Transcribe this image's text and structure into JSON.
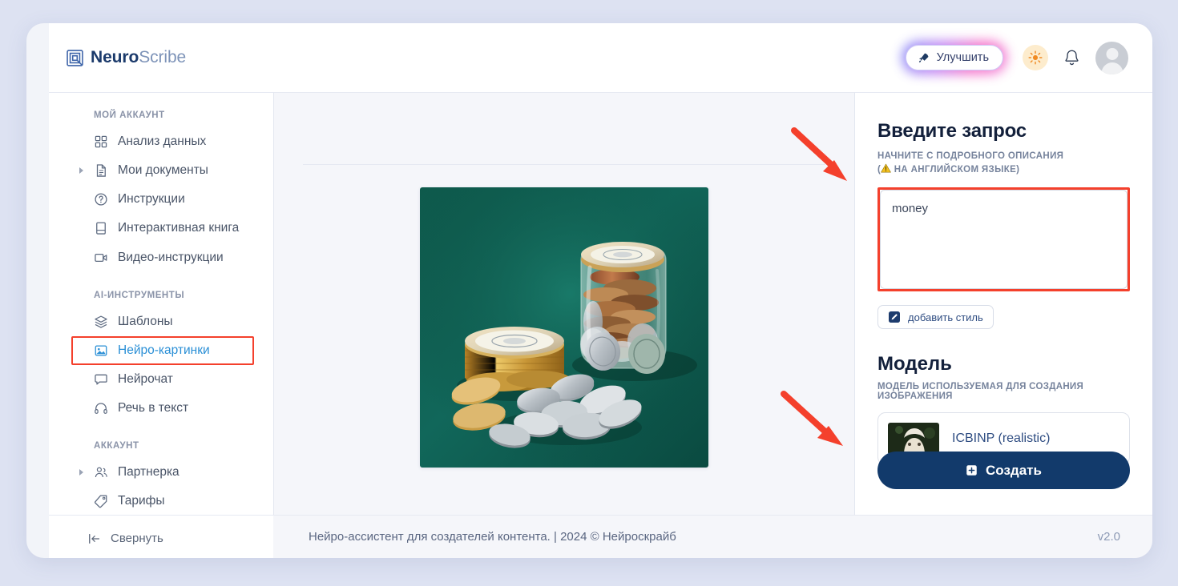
{
  "brand": {
    "name_strong": "Neuro",
    "name_light": "Scribe",
    "logo_icon": "nested-square-logo-icon"
  },
  "header": {
    "improve_label": "Улучшить",
    "improve_icon": "rocket-icon",
    "theme_icon": "sun-icon",
    "bell_icon": "bell-icon",
    "avatar_icon": "user-avatar-icon"
  },
  "sidebar": {
    "groups": [
      {
        "label": "МОЙ АККАУНТ",
        "items": [
          {
            "label": "Анализ данных",
            "icon": "grid-squares-icon",
            "expandable": false,
            "active": false,
            "highlighted": false
          },
          {
            "label": "Мои документы",
            "icon": "document-icon",
            "expandable": true,
            "active": false,
            "highlighted": false
          },
          {
            "label": "Инструкции",
            "icon": "question-circle-icon",
            "expandable": false,
            "active": false,
            "highlighted": false
          },
          {
            "label": "Интерактивная книга",
            "icon": "book-icon",
            "expandable": false,
            "active": false,
            "highlighted": false
          },
          {
            "label": "Видео-инструкции",
            "icon": "video-camera-icon",
            "expandable": false,
            "active": false,
            "highlighted": false
          }
        ]
      },
      {
        "label": "AI-ИНСТРУМЕНТЫ",
        "items": [
          {
            "label": "Шаблоны",
            "icon": "layers-icon",
            "expandable": false,
            "active": false,
            "highlighted": false
          },
          {
            "label": "Нейро-картинки",
            "icon": "image-icon",
            "expandable": false,
            "active": true,
            "highlighted": true
          },
          {
            "label": "Нейрочат",
            "icon": "chat-bubble-icon",
            "expandable": false,
            "active": false,
            "highlighted": false
          },
          {
            "label": "Речь в текст",
            "icon": "headphones-icon",
            "expandable": false,
            "active": false,
            "highlighted": false
          }
        ]
      },
      {
        "label": "АККАУНТ",
        "items": [
          {
            "label": "Партнерка",
            "icon": "users-icon",
            "expandable": true,
            "active": false,
            "highlighted": false
          },
          {
            "label": "Тарифы",
            "icon": "tag-icon",
            "expandable": false,
            "active": false,
            "highlighted": false
          }
        ]
      }
    ],
    "collapse_label": "Свернуть",
    "collapse_icon": "collapse-left-icon"
  },
  "main": {
    "generated_image_alt": "Стеклянная банка с монетами и стопка золотых монет на тёмно-зелёной поверхности"
  },
  "prompt": {
    "title": "Введите запрос",
    "subtitle_line1": "НАЧНИТЕ С ПОДРОБНОГО ОПИСАНИЯ",
    "subtitle_line2_prefix": "(",
    "subtitle_line2": "НА АНГЛИЙСКОМ ЯЗЫКЕ)",
    "warning_icon": "warning-triangle-icon",
    "value": "money",
    "placeholder": "",
    "style_button_label": "добавить стиль",
    "style_button_icon": "edit-square-icon"
  },
  "model": {
    "title": "Модель",
    "subtitle": "МОДЕЛЬ ИСПОЛЬЗУЕМАЯ ДЛЯ СОЗДАНИЯ ИЗОБРАЖЕНИЯ",
    "selected_name": "ICBINP (realistic)",
    "thumb_icon": "model-preview-thumbnail"
  },
  "create_button": {
    "label": "Создать",
    "icon": "plus-square-icon",
    "color": "#123a6b"
  },
  "footer": {
    "text": "Нейро-ассистент для создателей контента.  | 2024 © Нейроскрайб",
    "version": "v2.0"
  },
  "annotations": {
    "highlight_color": "#f4402c",
    "arrow_prompt": "arrow-pointing-to-prompt-textarea",
    "arrow_create": "arrow-pointing-to-create-button"
  }
}
